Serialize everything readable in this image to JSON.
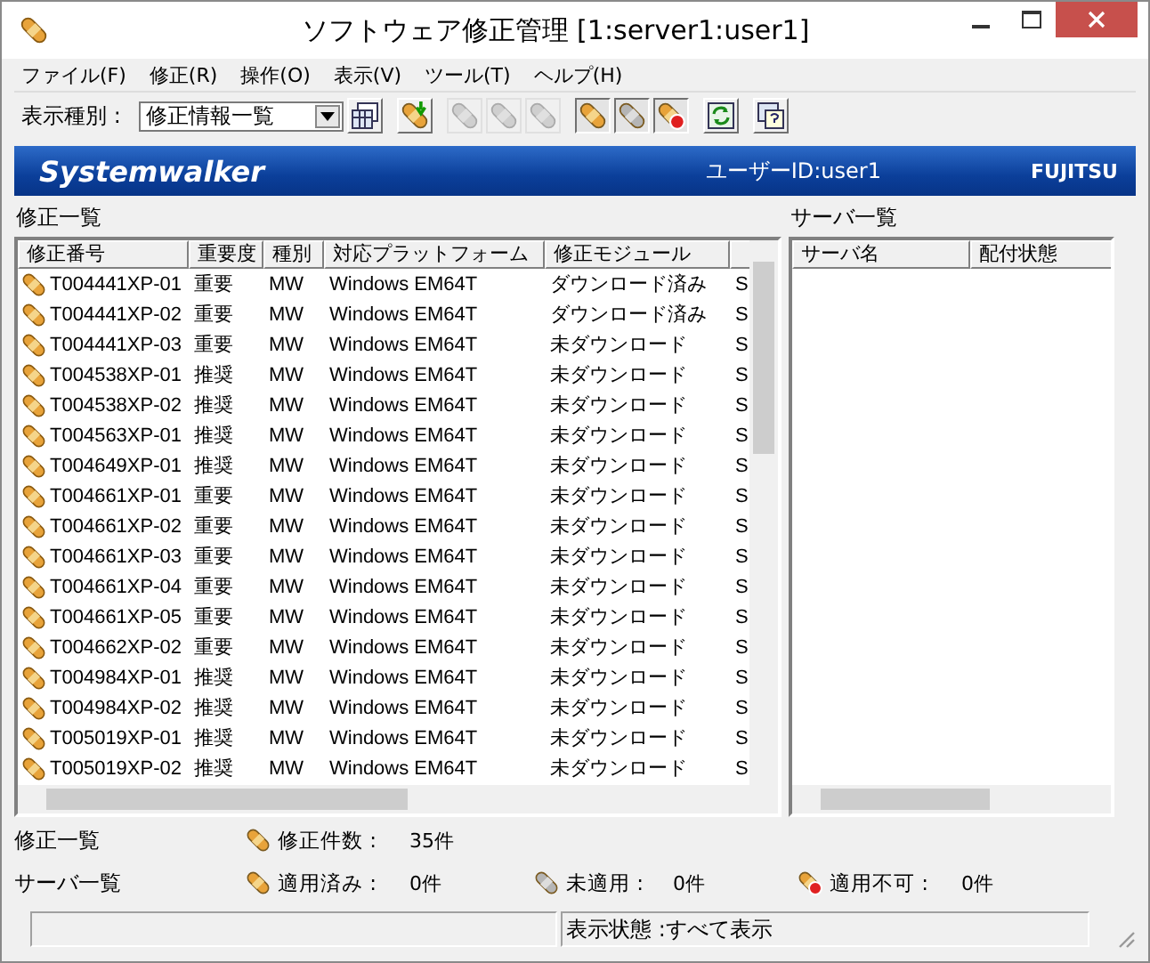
{
  "window": {
    "title": "ソフトウェア修正管理 [1:server1:user1]"
  },
  "menu": [
    {
      "label": "ファイル(F)"
    },
    {
      "label": "修正(R)"
    },
    {
      "label": "操作(O)"
    },
    {
      "label": "表示(V)"
    },
    {
      "label": "ツール(T)"
    },
    {
      "label": "ヘルプ(H)"
    }
  ],
  "toolbar": {
    "view_label": "表示種別 :",
    "view_select": "修正情報一覧",
    "buttons": [
      {
        "kind": "columns",
        "disabled": false,
        "pressed": false
      },
      {
        "kind": "download",
        "disabled": false,
        "pressed": false
      },
      {
        "kind": "apply",
        "disabled": true,
        "pressed": false
      },
      {
        "kind": "distribute",
        "disabled": true,
        "pressed": false
      },
      {
        "kind": "remove",
        "disabled": true,
        "pressed": false
      },
      {
        "kind": "applied",
        "disabled": false,
        "pressed": true
      },
      {
        "kind": "unapplied",
        "disabled": false,
        "pressed": true
      },
      {
        "kind": "unapplicable",
        "disabled": false,
        "pressed": true
      },
      {
        "kind": "refresh",
        "disabled": false,
        "pressed": false
      },
      {
        "kind": "help",
        "disabled": false,
        "pressed": false
      }
    ]
  },
  "banner": {
    "logo": "Systemwalker",
    "user": "ユーザーID:user1",
    "brand": "FUJITSU"
  },
  "fix_list": {
    "title": "修正一覧",
    "columns": [
      "修正番号",
      "重要度",
      "種別",
      "対応プラットフォーム",
      "修正モジュール"
    ],
    "rows": [
      [
        "T004441XP-01",
        "重要",
        "MW",
        "Windows EM64T",
        "ダウンロード済み",
        "S"
      ],
      [
        "T004441XP-02",
        "重要",
        "MW",
        "Windows EM64T",
        "ダウンロード済み",
        "S"
      ],
      [
        "T004441XP-03",
        "重要",
        "MW",
        "Windows EM64T",
        "未ダウンロード",
        "S"
      ],
      [
        "T004538XP-01",
        "推奨",
        "MW",
        "Windows EM64T",
        "未ダウンロード",
        "S"
      ],
      [
        "T004538XP-02",
        "推奨",
        "MW",
        "Windows EM64T",
        "未ダウンロード",
        "S"
      ],
      [
        "T004563XP-01",
        "推奨",
        "MW",
        "Windows EM64T",
        "未ダウンロード",
        "S"
      ],
      [
        "T004649XP-01",
        "推奨",
        "MW",
        "Windows EM64T",
        "未ダウンロード",
        "S"
      ],
      [
        "T004661XP-01",
        "重要",
        "MW",
        "Windows EM64T",
        "未ダウンロード",
        "S"
      ],
      [
        "T004661XP-02",
        "重要",
        "MW",
        "Windows EM64T",
        "未ダウンロード",
        "S"
      ],
      [
        "T004661XP-03",
        "重要",
        "MW",
        "Windows EM64T",
        "未ダウンロード",
        "S"
      ],
      [
        "T004661XP-04",
        "重要",
        "MW",
        "Windows EM64T",
        "未ダウンロード",
        "S"
      ],
      [
        "T004661XP-05",
        "重要",
        "MW",
        "Windows EM64T",
        "未ダウンロード",
        "S"
      ],
      [
        "T004662XP-02",
        "重要",
        "MW",
        "Windows EM64T",
        "未ダウンロード",
        "S"
      ],
      [
        "T004984XP-01",
        "推奨",
        "MW",
        "Windows EM64T",
        "未ダウンロード",
        "S"
      ],
      [
        "T004984XP-02",
        "推奨",
        "MW",
        "Windows EM64T",
        "未ダウンロード",
        "S"
      ],
      [
        "T005019XP-01",
        "推奨",
        "MW",
        "Windows EM64T",
        "未ダウンロード",
        "S"
      ],
      [
        "T005019XP-02",
        "推奨",
        "MW",
        "Windows EM64T",
        "未ダウンロード",
        "S"
      ]
    ]
  },
  "server_list": {
    "title": "サーバ一覧",
    "columns": [
      "サーバ名",
      "配付状態"
    ]
  },
  "summary": [
    {
      "label": "修正一覧",
      "counts": [
        {
          "kind": "fix",
          "label": "修正件数 :",
          "value": "35件"
        }
      ]
    },
    {
      "label": "サーバ一覧",
      "counts": [
        {
          "kind": "applied",
          "label": "適用済み :",
          "value": "0件"
        },
        {
          "kind": "unapplied",
          "label": "未適用 :",
          "value": "0件"
        },
        {
          "kind": "unapplicable",
          "label": "適用不可 :",
          "value": "0件"
        }
      ]
    }
  ],
  "status_bar": {
    "display_state": "表示状態 :すべて表示"
  }
}
